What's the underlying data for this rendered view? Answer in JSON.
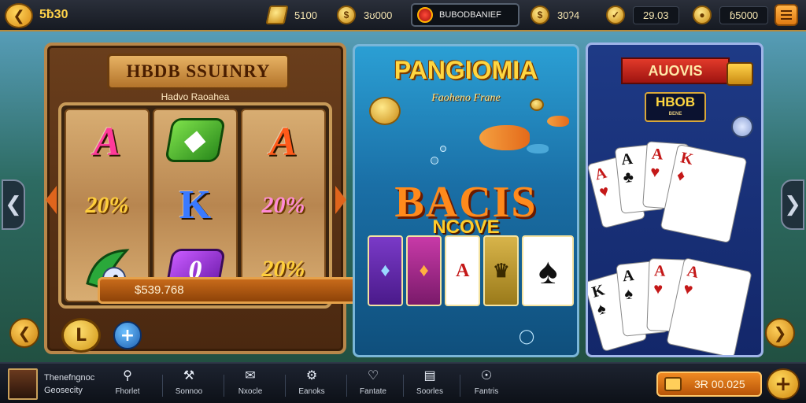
{
  "topbar": {
    "balance": "5ƀ30",
    "stats": [
      {
        "icon": "gold-bar-icon",
        "value": "5100"
      },
      {
        "icon": "gold-coin-icon",
        "value": "3ʊ000"
      },
      {
        "icon": "bonus-coin-icon",
        "value": "30ʔ4"
      },
      {
        "icon": "medal-icon",
        "value": "29.03"
      },
      {
        "icon": "gem-coin-icon",
        "value": "ɓ5000"
      }
    ],
    "player_name": "BUBODBANIEF"
  },
  "slots": {
    "title": "HBDB SSUINRY",
    "subtitle": "Hadvo Raoahea",
    "amount": "$539.768"
  },
  "fish": {
    "title": "PANGIOMIA",
    "subtitle": "Faoheno Frane",
    "headline": "BACIS",
    "overlay": "NCOVE"
  },
  "cards": {
    "ribbon": "AUOVIS",
    "badge": "HBOB",
    "badge_small": "BENE"
  },
  "bottombar": {
    "profile_line1": "Thenefngnoc",
    "profile_line2": "Geosecity",
    "nav": [
      {
        "icon": "search-icon",
        "label": "Fhorlet"
      },
      {
        "icon": "hammer-icon",
        "label": "Sonnoo"
      },
      {
        "icon": "chat-icon",
        "label": "Nxocle"
      },
      {
        "icon": "tool-icon",
        "label": "Eanoks"
      },
      {
        "icon": "heart-icon",
        "label": "Fantate"
      },
      {
        "icon": "cards-icon",
        "label": "Soorles"
      },
      {
        "icon": "globe-icon",
        "label": "Fantris"
      }
    ],
    "total": "3Ɍ 00.025"
  },
  "colors": {
    "accent_gold": "#ffd640",
    "accent_orange": "#e07b12",
    "bar_dark": "#161a22"
  }
}
